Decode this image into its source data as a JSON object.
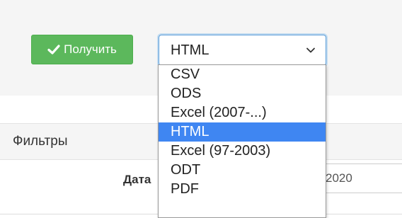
{
  "toolbar": {
    "get_button_label": "Получить",
    "format_select_value": "HTML"
  },
  "format_options": [
    "CSV",
    "ODS",
    "Excel (2007-...)",
    "HTML",
    "Excel (97-2003)",
    "ODT",
    "PDF"
  ],
  "selected_option": "HTML",
  "filters": {
    "title": "Фильтры",
    "date_label": "Дата",
    "date_value": "2020"
  },
  "colors": {
    "button_green": "#5cb85c",
    "selected_highlight": "#3f86f2",
    "focus_border": "#5b9dd9"
  },
  "icons": {
    "button_icon": "check-icon",
    "select_icon": "chevron-down-icon"
  }
}
